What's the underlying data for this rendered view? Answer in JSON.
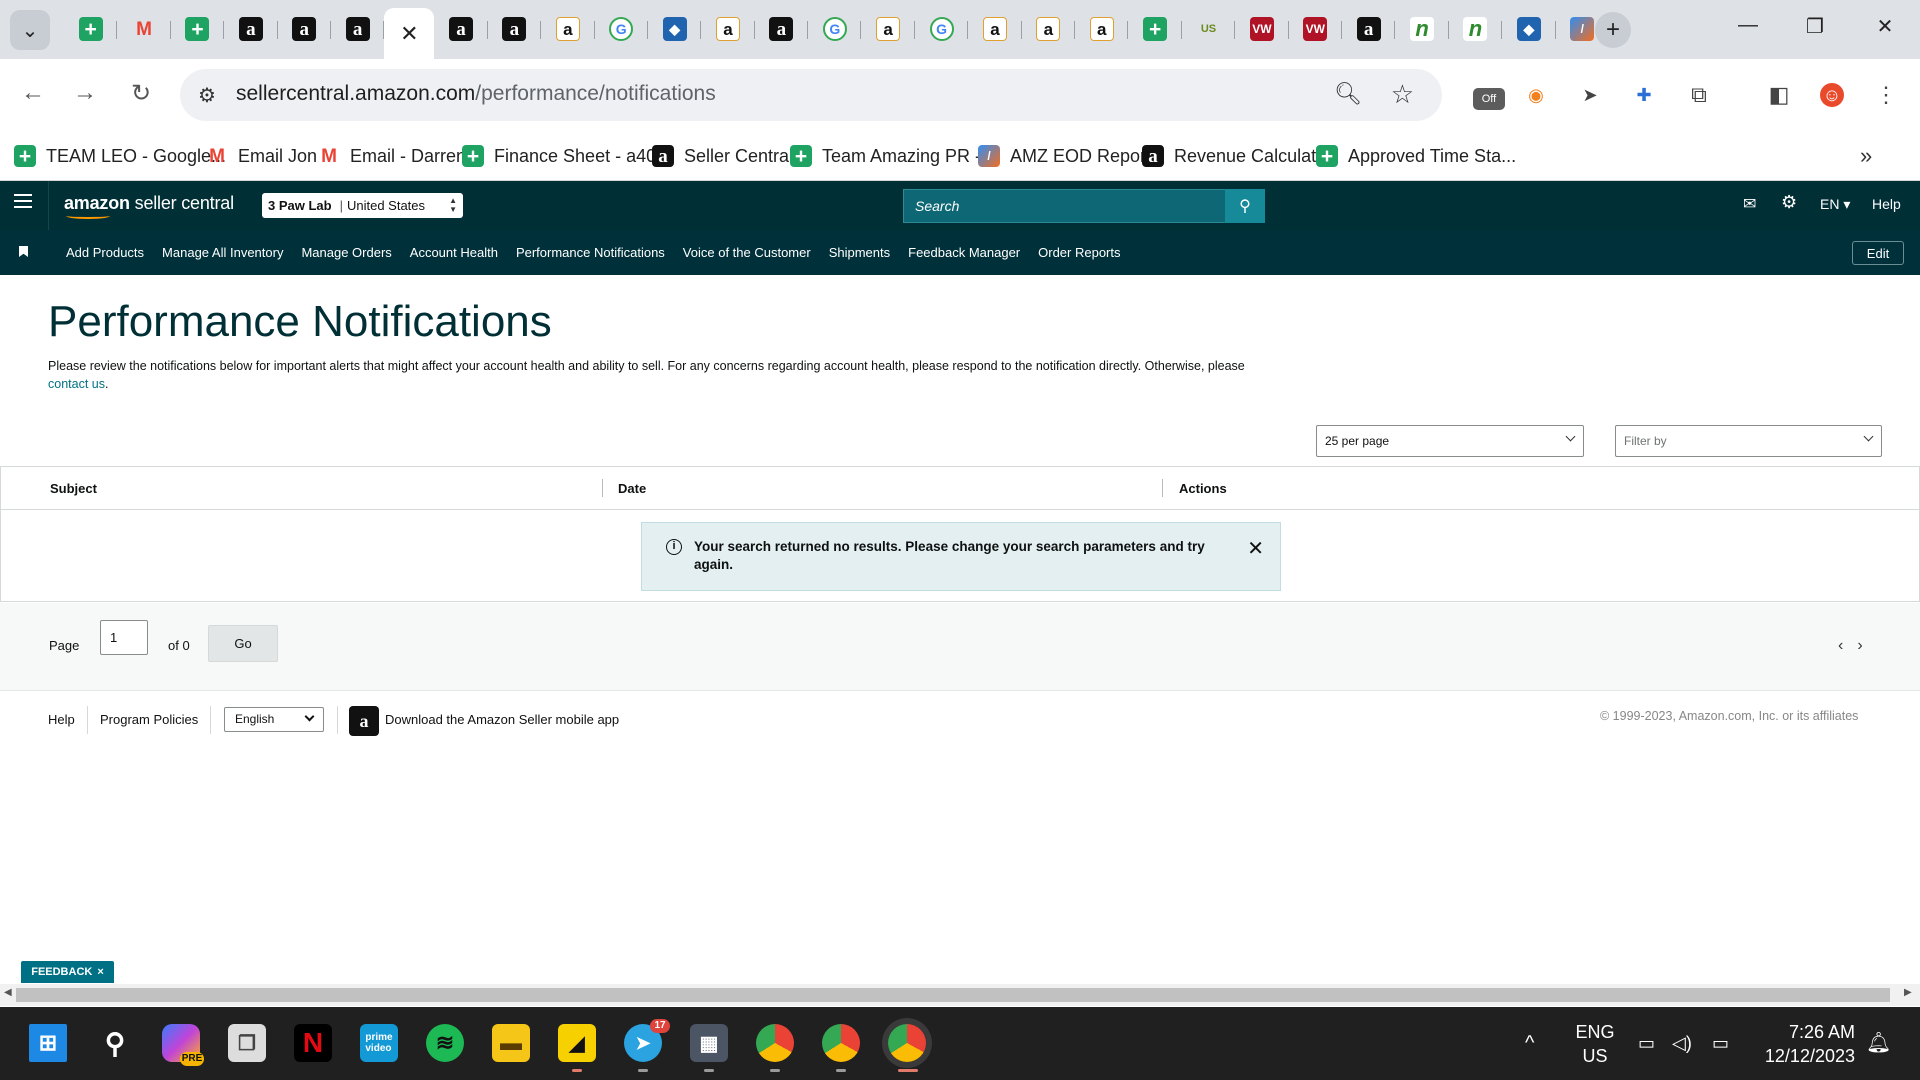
{
  "browser": {
    "tabs": [
      {
        "icon": "sheets-icon",
        "glyph": "+",
        "cls": "sheets"
      },
      {
        "icon": "gmail-icon",
        "glyph": "M",
        "cls": "gmail"
      },
      {
        "icon": "sheets-icon",
        "glyph": "+",
        "cls": "sheets"
      },
      {
        "icon": "amazon-icon",
        "glyph": "a",
        "cls": "amazon"
      },
      {
        "icon": "amazon-icon",
        "glyph": "a",
        "cls": "amazon"
      },
      {
        "icon": "amazon-icon",
        "glyph": "a",
        "cls": "amazon"
      },
      {
        "icon": "close-icon",
        "glyph": "✕",
        "cls": "active"
      },
      {
        "icon": "amazon-icon",
        "glyph": "a",
        "cls": "amazon"
      },
      {
        "icon": "amazon-icon",
        "glyph": "a",
        "cls": "amazon"
      },
      {
        "icon": "amazon-icon",
        "glyph": "a",
        "cls": "amazon-w"
      },
      {
        "icon": "google-icon",
        "glyph": "G",
        "cls": "google"
      },
      {
        "icon": "diamond-icon",
        "glyph": "◆",
        "cls": "diamond"
      },
      {
        "icon": "amazon-icon",
        "glyph": "a",
        "cls": "amazon-w"
      },
      {
        "icon": "amazon-icon",
        "glyph": "a",
        "cls": "amazon"
      },
      {
        "icon": "google-icon",
        "glyph": "G",
        "cls": "google"
      },
      {
        "icon": "amazon-icon",
        "glyph": "a",
        "cls": "amazon-w"
      },
      {
        "icon": "google-icon",
        "glyph": "G",
        "cls": "google"
      },
      {
        "icon": "amazon-icon",
        "glyph": "a",
        "cls": "amazon-w"
      },
      {
        "icon": "amazon-icon",
        "glyph": "a",
        "cls": "amazon-w"
      },
      {
        "icon": "amazon-icon",
        "glyph": "a",
        "cls": "amazon-w"
      },
      {
        "icon": "sheets-icon",
        "glyph": "+",
        "cls": "sheets"
      },
      {
        "icon": "usfoods-icon",
        "glyph": "US",
        "cls": "usfoods"
      },
      {
        "icon": "vw-icon",
        "glyph": "VW",
        "cls": "vw"
      },
      {
        "icon": "vw-icon",
        "glyph": "VW",
        "cls": "vw"
      },
      {
        "icon": "amazon-icon",
        "glyph": "a",
        "cls": "amazon"
      },
      {
        "icon": "n-icon",
        "glyph": "n",
        "cls": "ncheck"
      },
      {
        "icon": "n-icon",
        "glyph": "n",
        "cls": "ncheck"
      },
      {
        "icon": "diamond-icon",
        "glyph": "◆",
        "cls": "diamond"
      },
      {
        "icon": "amz-eod-icon",
        "glyph": "/",
        "cls": "amz-eod"
      }
    ],
    "url_host": "sellercentral.amazon.com",
    "url_path": "/performance/notifications",
    "ext_off_label": "Off",
    "bookmarks": [
      {
        "icon": "sheets-icon",
        "glyph": "+",
        "cls": "sheets",
        "label": "TEAM LEO - Google..."
      },
      {
        "icon": "gmail-icon",
        "glyph": "M",
        "cls": "gmail",
        "label": "Email Jon"
      },
      {
        "icon": "gmail-icon",
        "glyph": "M",
        "cls": "gmail",
        "label": "Email - Darren"
      },
      {
        "icon": "sheets-icon",
        "glyph": "+",
        "cls": "sheets",
        "label": "Finance Sheet - a40..."
      },
      {
        "icon": "amazon-icon",
        "glyph": "a",
        "cls": "amazon",
        "label": "Seller Central"
      },
      {
        "icon": "sheets-icon",
        "glyph": "+",
        "cls": "sheets",
        "label": "Team Amazing PR -..."
      },
      {
        "icon": "amz-eod-icon",
        "glyph": "/",
        "cls": "amz-eod",
        "label": "AMZ EOD Report"
      },
      {
        "icon": "amazon-icon",
        "glyph": "a",
        "cls": "amazon",
        "label": "Revenue Calculator"
      },
      {
        "icon": "sheets-icon",
        "glyph": "+",
        "cls": "sheets",
        "label": "Approved Time Sta..."
      }
    ]
  },
  "header": {
    "logo_main": "amazon",
    "logo_sub": "seller central",
    "account_name": "3 Paw Lab",
    "account_sep": "|",
    "account_region": "United States",
    "search_placeholder": "Search",
    "language": "EN",
    "help": "Help"
  },
  "subnav": {
    "items": [
      "Add Products",
      "Manage All Inventory",
      "Manage Orders",
      "Account Health",
      "Performance Notifications",
      "Voice of the Customer",
      "Shipments",
      "Feedback Manager",
      "Order Reports"
    ],
    "edit": "Edit"
  },
  "page": {
    "title": "Performance Notifications",
    "intro_before": "Please review the notifications below for important alerts that might affect your account health and ability to sell. For any concerns regarding account health, please respond to the notification directly. Otherwise, please ",
    "intro_link": "contact us",
    "intro_after": ".",
    "per_page": "25 per page",
    "filter_placeholder": "Filter by"
  },
  "table": {
    "columns": [
      "Subject",
      "Date",
      "Actions"
    ],
    "alert": "Your search returned no results. Please change your search parameters and try again."
  },
  "pager": {
    "label": "Page",
    "value": "1",
    "of": "of 0",
    "go": "Go"
  },
  "footer": {
    "help": "Help",
    "policies": "Program Policies",
    "language": "English",
    "app_link": "Download the Amazon Seller mobile app",
    "copyright": "© 1999-2023, Amazon.com, Inc. or its affiliates"
  },
  "feedback": {
    "label": "FEEDBACK",
    "close": "×"
  },
  "taskbar": {
    "lang_top": "ENG",
    "lang_bottom": "US",
    "time": "7:26 AM",
    "date": "12/12/2023",
    "telegram_badge": "17",
    "copilot_badge": "PRE"
  }
}
